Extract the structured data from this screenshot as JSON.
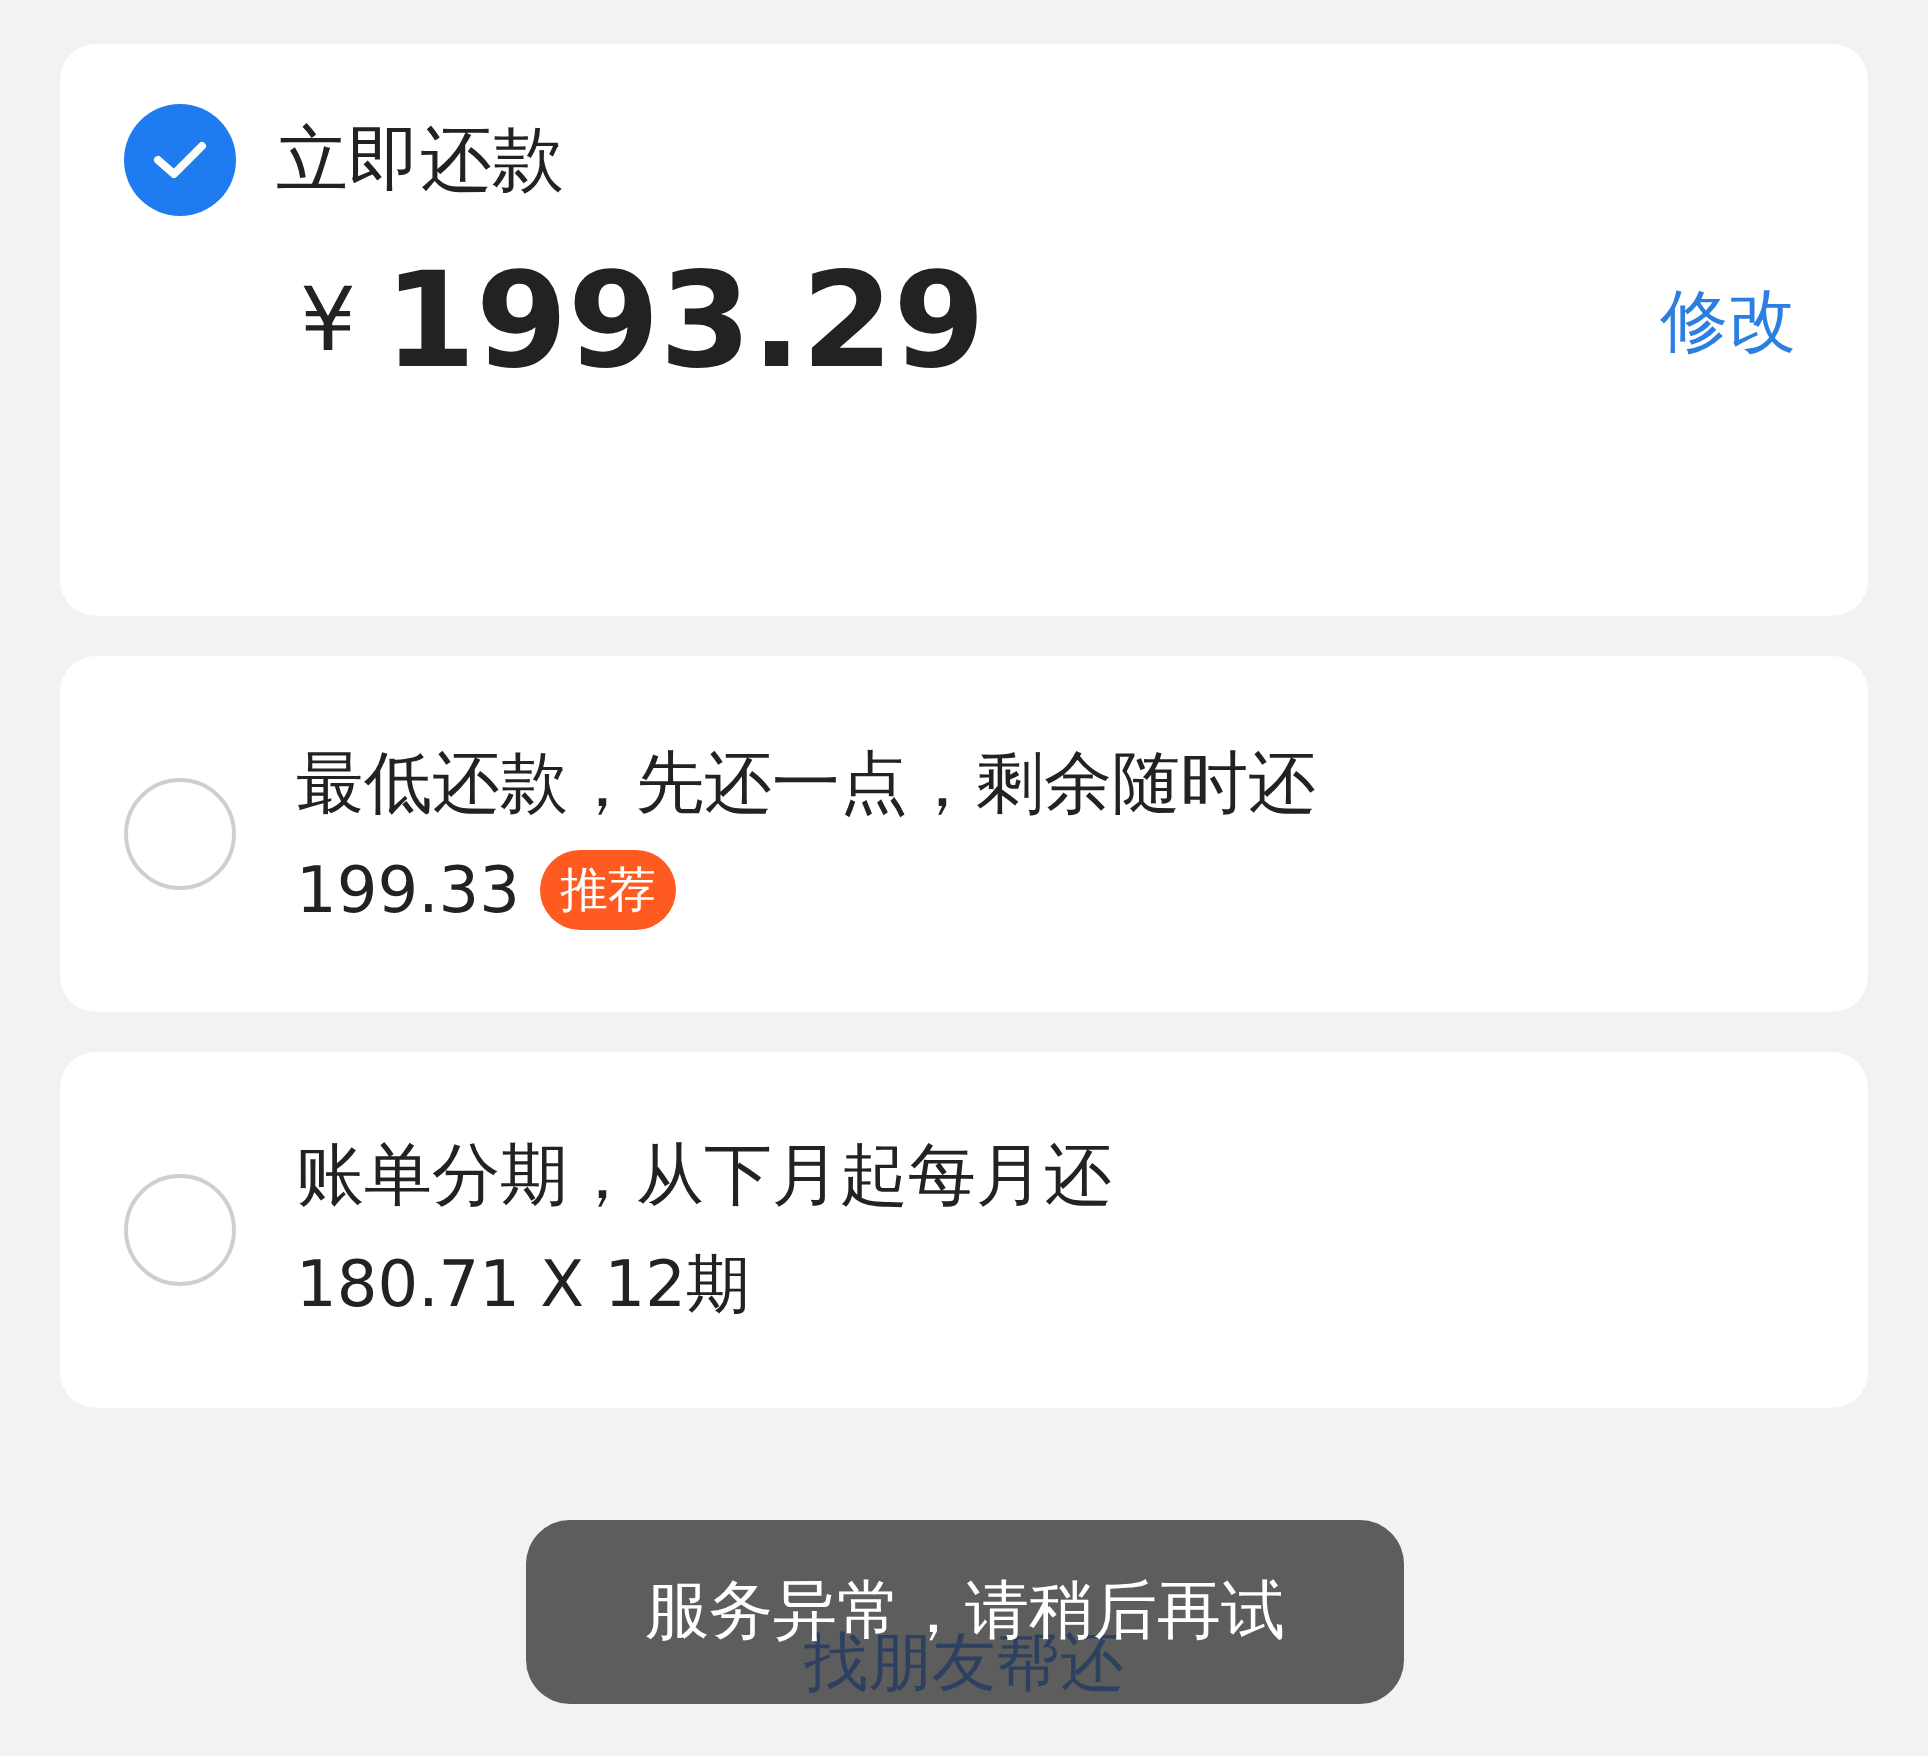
{
  "full_repayment": {
    "label": "立即还款",
    "currency": "¥",
    "amount": "1993.29",
    "edit_link": "修改",
    "selected": true
  },
  "options": [
    {
      "title": "最低还款，先还一点，剩余随时还",
      "amount": "199.33",
      "badge": "推荐",
      "selected": false
    },
    {
      "title": "账单分期，从下月起每月还",
      "amount": "180.71 X 12期",
      "selected": false
    }
  ],
  "friend_link": "找朋友帮还",
  "toast": "服务异常，请稍后再试"
}
